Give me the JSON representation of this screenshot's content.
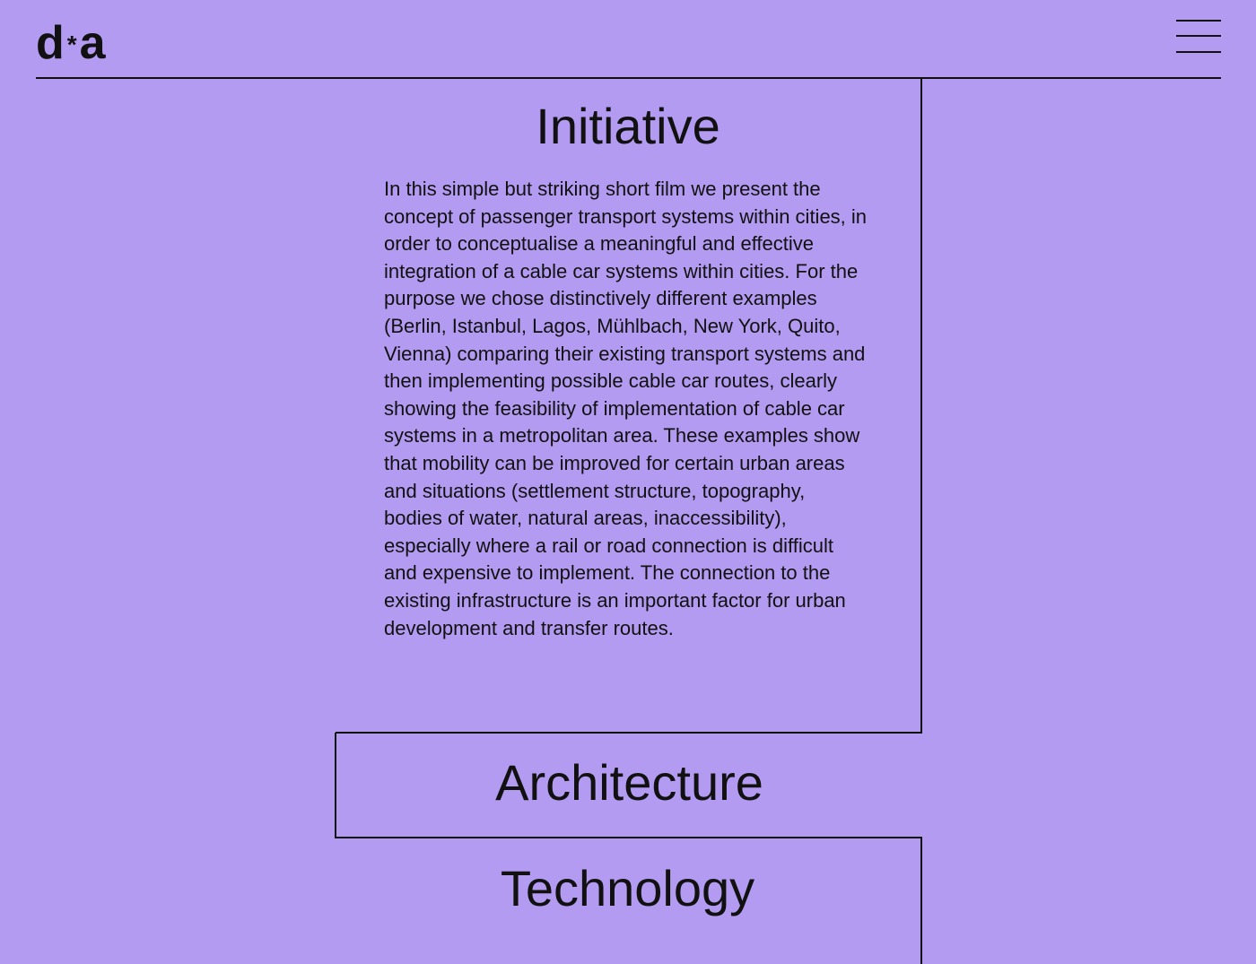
{
  "header": {
    "logo": {
      "left": "d",
      "star": "*",
      "right": "a"
    },
    "menu_icon": "hamburger-menu-icon"
  },
  "sections": [
    {
      "title": "Initiative",
      "body": "In this simple but striking short film we present the concept of passenger transport systems within cities, in order to conceptualise a meaningful and effective integration of a cable car systems within cities. For the purpose we chose distinctively different examples (Berlin, Istanbul, Lagos, Mühlbach, New York, Quito, Vienna) comparing their existing transport systems and then implementing possible cable car routes, clearly showing the feasibility of implementation of cable car systems in a metropolitan area. These examples show that mobility can be improved for certain urban areas and situations (settlement structure, topography, bodies of water, natural areas, inaccessibility), especially where a rail or road connection is difficult and expensive to implement. The connection to the existing infrastructure is an important factor for urban development and transfer routes."
    },
    {
      "title": "Architecture"
    },
    {
      "title": "Technology"
    }
  ],
  "colors": {
    "background": "#b29bf1",
    "text": "#111111",
    "rule": "#111111"
  }
}
